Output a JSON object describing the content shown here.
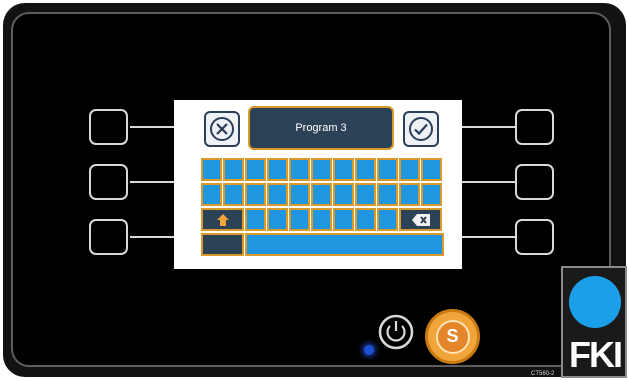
{
  "screen": {
    "title": "Program 3"
  },
  "keyboard": {
    "row1_keys": 11,
    "row2_keys": 11,
    "row3_keys": 7,
    "shift_icon": "shift-arrow-icon",
    "backspace_icon": "backspace-icon"
  },
  "controls": {
    "cancel_icon": "close-circle-icon",
    "confirm_icon": "check-circle-icon",
    "power_icon": "power-icon",
    "s_label": "S"
  },
  "branding": {
    "logo_text": "FKI",
    "model_label": "CT560-2"
  },
  "colors": {
    "key_fill": "#1f97e0",
    "key_border": "#d99a2a",
    "dark_fill": "#2c4257",
    "accent_orange": "#f0a43a",
    "logo_blue": "#1a9fe8"
  }
}
